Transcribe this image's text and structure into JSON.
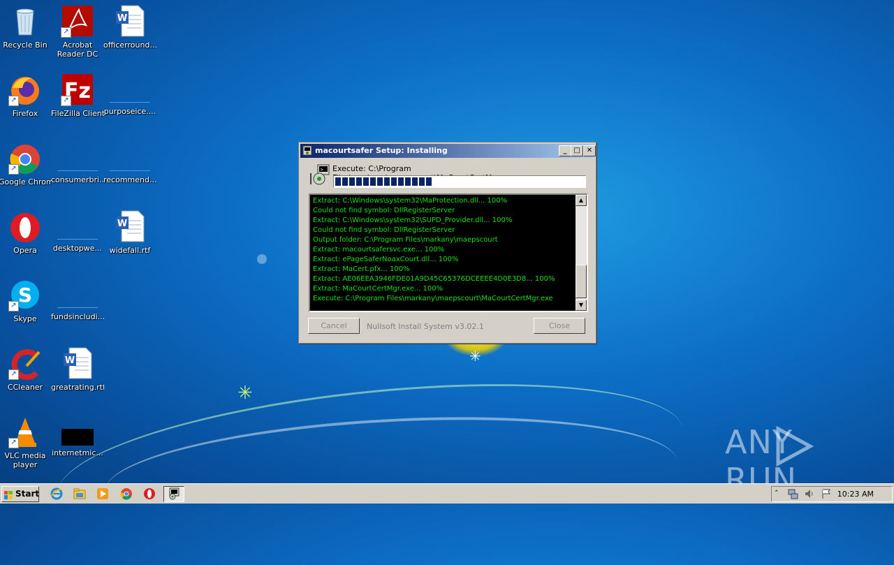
{
  "desktop": {
    "icons": [
      {
        "label": "Recycle Bin"
      },
      {
        "label": "Acrobat Reader DC"
      },
      {
        "label": "officerround..."
      },
      {
        "label": "Firefox"
      },
      {
        "label": "FileZilla Client"
      },
      {
        "label": "purposeice...."
      },
      {
        "label": "Google Chrome"
      },
      {
        "label": "consumerbri..."
      },
      {
        "label": "recommend..."
      },
      {
        "label": "Opera"
      },
      {
        "label": "desktopwe..."
      },
      {
        "label": "widefall.rtf"
      },
      {
        "label": "Skype"
      },
      {
        "label": "fundsincludi..."
      },
      {
        "label": "CCleaner"
      },
      {
        "label": "greatrating.rtf"
      },
      {
        "label": "VLC media player"
      },
      {
        "label": "internetmic..."
      }
    ]
  },
  "dialog": {
    "title": "macourtsafer Setup: Installing",
    "exec_line": "Execute: C:\\Program Files\\markany\\maepscourt\\MaCourtCertMgr.exe",
    "progress_fraction": 0.39,
    "log": [
      "Extract: C:\\Windows\\system32\\MaProtection.dll... 100%",
      "Could not find symbol: DllRegisterServer",
      "Extract: C:\\Windows\\system32\\SUPD_Provider.dll... 100%",
      "Could not find symbol: DllRegisterServer",
      "Output folder: C:\\Program Files\\markany\\maepscourt",
      "Extract: macourtsafersvc.exe... 100%",
      "Extract: ePageSaferNoaxCourt.dll... 100%",
      "Extract: MaCert.pfx... 100%",
      "Extract: AE06EEA3946FDE01A9D45C65376DCEEEE4D0E3D8... 100%",
      "Extract: MaCourtCertMgr.exe... 100%",
      "Execute: C:\\Program Files\\markany\\maepscourt\\MaCourtCertMgr.exe"
    ],
    "cancel_label": "Cancel",
    "nsis_label": "Nullsoft Install System v3.02.1",
    "close_label": "Close"
  },
  "taskbar": {
    "start_label": "Start",
    "clock": "10:23 AM"
  },
  "watermark": {
    "left": "ANY",
    "right": "RUN"
  }
}
